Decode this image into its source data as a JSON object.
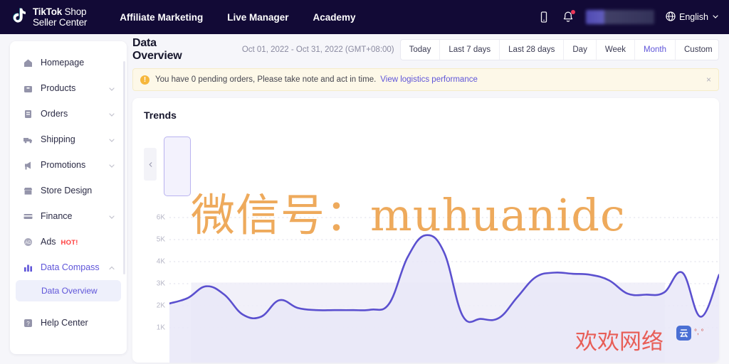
{
  "topnav": {
    "brand": {
      "line1_bold": "TikTok",
      "line1_light": "Shop",
      "line2": "Seller Center",
      "logo_icon": "tiktok-note-icon"
    },
    "links": [
      {
        "label": "Affiliate Marketing"
      },
      {
        "label": "Live Manager"
      },
      {
        "label": "Academy"
      }
    ],
    "icons": [
      {
        "name": "mobile-app-icon"
      },
      {
        "name": "notification-bell-icon",
        "has_badge": true
      }
    ],
    "account_blurred": "",
    "language": {
      "label": "English",
      "icon": "globe-icon",
      "caret": "chevron-down-icon"
    }
  },
  "sidebar": {
    "items": [
      {
        "label": "Homepage",
        "icon": "home-icon",
        "expandable": false,
        "active": false
      },
      {
        "label": "Products",
        "icon": "products-bag-icon",
        "expandable": true,
        "active": false
      },
      {
        "label": "Orders",
        "icon": "orders-list-icon",
        "expandable": true,
        "active": false
      },
      {
        "label": "Shipping",
        "icon": "shipping-truck-icon",
        "expandable": true,
        "active": false
      },
      {
        "label": "Promotions",
        "icon": "promotions-megaphone-icon",
        "expandable": true,
        "active": false
      },
      {
        "label": "Store Design",
        "icon": "store-icon",
        "expandable": false,
        "active": false
      },
      {
        "label": "Finance",
        "icon": "finance-card-icon",
        "expandable": true,
        "active": false
      },
      {
        "label": "Ads",
        "icon": "ads-icon",
        "expandable": false,
        "active": false,
        "badge": "HOT!"
      },
      {
        "label": "Data Compass",
        "icon": "data-compass-bars-icon",
        "expandable": true,
        "active": true,
        "expanded": true
      }
    ],
    "subitem": {
      "label": "Data Overview",
      "active": true
    },
    "footer_item": {
      "label": "Help Center",
      "icon": "help-center-icon"
    }
  },
  "page": {
    "title": "Data Overview",
    "date_range": "Oct 01, 2022 - Oct 31, 2022 (GMT+08:00)",
    "range_tabs": [
      {
        "label": "Today",
        "active": false
      },
      {
        "label": "Last 7 days",
        "active": false
      },
      {
        "label": "Last 28 days",
        "active": false
      },
      {
        "label": "Day",
        "active": false
      },
      {
        "label": "Week",
        "active": false
      },
      {
        "label": "Month",
        "active": true
      },
      {
        "label": "Custom",
        "active": false
      }
    ]
  },
  "alert": {
    "icon": "warning-exclamation-icon",
    "text": "You have 0 pending orders, Please take note and act in time.",
    "link": "View logistics performance",
    "close": "×"
  },
  "panel": {
    "title": "Trends",
    "scroll_left_icon": "chevron-left-icon",
    "selected_metric_card": ""
  },
  "watermarks": {
    "orange": "微信号：muhuanidc",
    "red": "欢欢网络",
    "badge_glyph": "云",
    "small": "°, °"
  },
  "colors": {
    "header_bg": "#120a36",
    "accent": "#5f55d9",
    "chart_line": "#5b50cf",
    "alert_bg": "#fdf8e8",
    "warn": "#f6b73c",
    "hot": "#ff3b3b",
    "watermark_orange": "#eda34f",
    "watermark_red": "#e8534a"
  },
  "chart_data": {
    "type": "line",
    "title": "Trends",
    "xlabel": "",
    "ylabel": "",
    "ylim": [
      0,
      6500
    ],
    "grid": true,
    "legend_position": "none",
    "ytick_labels": [
      "6K",
      "5K",
      "4K",
      "3K",
      "2K",
      "1K"
    ],
    "ytick_values": [
      6000,
      5000,
      4000,
      3000,
      2000,
      1000
    ],
    "series": [
      {
        "name": "Trend",
        "color": "#5b50cf",
        "fill": "#e9e8f8",
        "x": [
          1,
          2,
          3,
          4,
          5,
          6,
          7,
          8,
          9,
          10,
          11,
          12,
          13,
          14,
          15,
          16,
          17,
          18,
          19,
          20,
          21,
          22,
          23,
          24,
          25,
          26,
          27,
          28,
          29,
          30,
          31
        ],
        "values": [
          2100,
          2350,
          2880,
          2500,
          1600,
          1500,
          2250,
          1900,
          1800,
          1800,
          1800,
          1820,
          2100,
          4200,
          5200,
          4400,
          1550,
          1400,
          1450,
          2400,
          3300,
          3500,
          3450,
          3400,
          3150,
          2550,
          2500,
          2600,
          3500,
          1500,
          3400
        ]
      }
    ]
  }
}
